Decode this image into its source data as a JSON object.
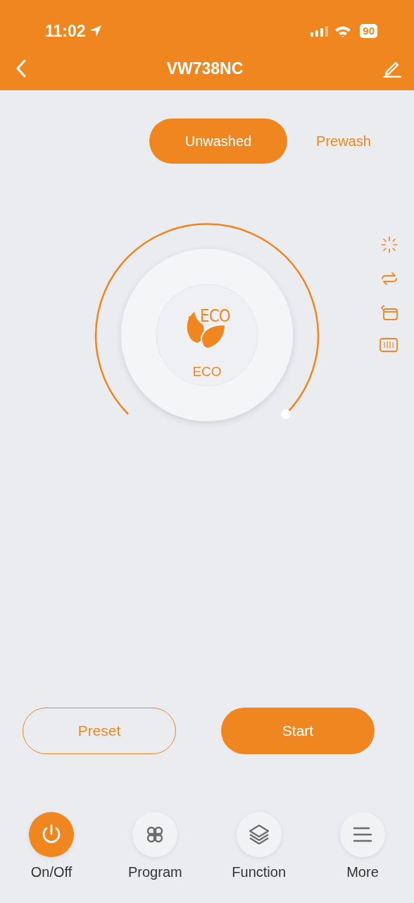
{
  "status_bar": {
    "time": "11:02",
    "battery": "90"
  },
  "header": {
    "title": "VW738NC"
  },
  "tabs": [
    {
      "label": "Unwashed",
      "selected": true
    },
    {
      "label": "Prewash",
      "selected": false
    }
  ],
  "dial": {
    "logo_text": "ECO",
    "label": "ECO"
  },
  "side_icons": [
    {
      "kind": "sparkle"
    },
    {
      "kind": "cycle"
    },
    {
      "kind": "basket"
    },
    {
      "kind": "rack"
    }
  ],
  "buttons": [
    {
      "label": "Preset",
      "kind": "outline"
    },
    {
      "label": "Start",
      "kind": "filled"
    }
  ],
  "nav": [
    {
      "label": "On/Off",
      "kind": "power",
      "on": true
    },
    {
      "label": "Program",
      "kind": "program",
      "on": false
    },
    {
      "label": "Function",
      "kind": "layers",
      "on": false
    },
    {
      "label": "More",
      "kind": "more",
      "on": false
    }
  ]
}
